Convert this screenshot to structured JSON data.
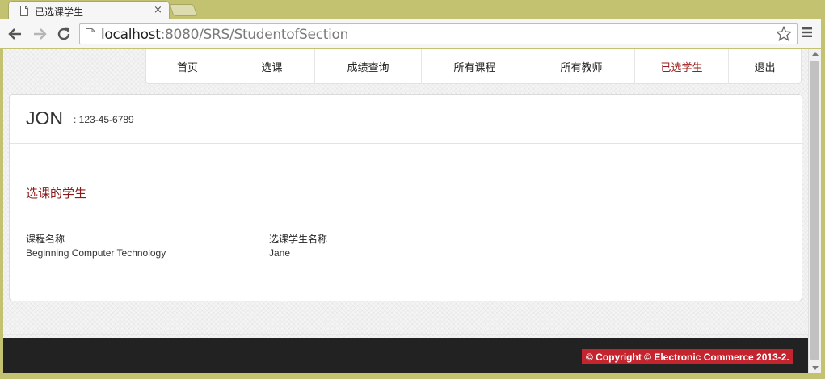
{
  "browser": {
    "tab_title": "已选课学生",
    "tab_close": "×",
    "url_host": "localhost",
    "url_rest": ":8080/SRS/StudentofSection"
  },
  "nav": {
    "items": [
      {
        "label": "首页",
        "active": false
      },
      {
        "label": "选课",
        "active": false
      },
      {
        "label": "成绩查询",
        "active": false
      },
      {
        "label": "所有课程",
        "active": false
      },
      {
        "label": "所有教师",
        "active": false
      },
      {
        "label": "已选学生",
        "active": true
      },
      {
        "label": "退出",
        "active": false
      }
    ]
  },
  "user": {
    "name": "JON",
    "id_text": ": 123-45-6789"
  },
  "section": {
    "title": "选课的学生",
    "columns": [
      "课程名称",
      "选课学生名称"
    ],
    "rows": [
      [
        "Beginning Computer Technology",
        "Jane"
      ]
    ]
  },
  "footer": {
    "copyright": "© Copyright © Electronic Commerce 2013-2."
  },
  "colors": {
    "accent": "#9b1c1c",
    "badge": "#c4242d",
    "footer_bg": "#222222",
    "chrome": "#c3c271"
  }
}
